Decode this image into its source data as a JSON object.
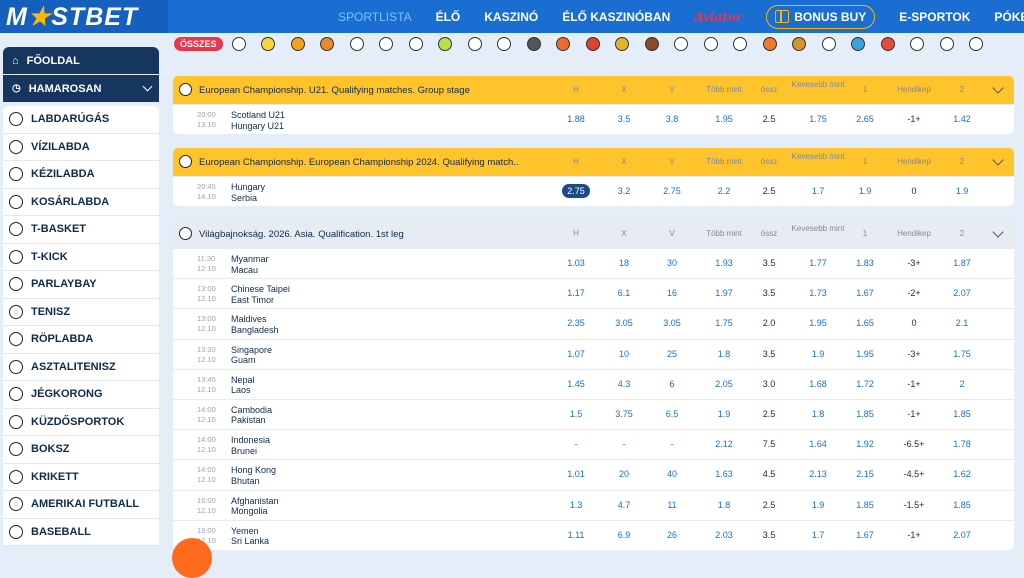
{
  "brand": {
    "logo_left": "M",
    "logo_star": "★",
    "logo_right": "STBET"
  },
  "topnav": {
    "items": [
      "SPORTLISTA",
      "ÉLŐ",
      "KASZINÓ",
      "ÉLŐ KASZINÓBAN",
      "Aviator",
      "BONUS BUY",
      "E-SPORTOK",
      "PÓKER"
    ]
  },
  "sidebar": {
    "home": "FŐOLDAL",
    "soon": "HAMAROSAN",
    "sports": [
      "LABDARÚGÁS",
      "VÍZILABDA",
      "KÉZILABDA",
      "KOSÁRLABDA",
      "T-BASKET",
      "T-KICK",
      "PARLAYBAY",
      "TENISZ",
      "RÖPLABDA",
      "ASZTALITENISZ",
      "JÉGKORONG",
      "KÜZDŐSPORTOK",
      "BOKSZ",
      "KRIKETT",
      "AMERIKAI FUTBALL",
      "BASEBALL"
    ]
  },
  "sport_filter": {
    "all_label": "ÖSSZES"
  },
  "columns": [
    "H",
    "X",
    "V",
    "Több mint",
    "össz",
    "Kevesebb mint",
    "1",
    "Hendikep",
    "2"
  ],
  "blocks": [
    {
      "title": "European Championship. U21. Qualifying matches. Group stage",
      "matches": [
        {
          "time": "20:00",
          "date": "13.10",
          "home": "Scotland U21",
          "away": "Hungary U21",
          "odds": [
            "1.88",
            "3.5",
            "3.8",
            "1.95",
            "2.5",
            "1.75",
            "2.65",
            "-1+",
            "1.42"
          ]
        }
      ]
    },
    {
      "title": "European Championship. European Championship 2024. Qualifying match...",
      "matches": [
        {
          "time": "20:45",
          "date": "14.10",
          "home": "Hungary",
          "away": "Serbia",
          "odds": [
            "2.75",
            "3.2",
            "2.75",
            "2.2",
            "2.5",
            "1.7",
            "1.9",
            "0",
            "1.9"
          ]
        }
      ]
    },
    {
      "title": "Világbajnokság. 2026. Asia. Qualification. 1st leg",
      "matches": [
        {
          "time": "11:30",
          "date": "12.10",
          "home": "Myanmar",
          "away": "Macau",
          "odds": [
            "1.03",
            "18",
            "30",
            "1.93",
            "3.5",
            "1.77",
            "1.83",
            "-3+",
            "1.87"
          ]
        },
        {
          "time": "13:00",
          "date": "12.10",
          "home": "Chinese Taipei",
          "away": "East Timor",
          "odds": [
            "1.17",
            "6.1",
            "16",
            "1.97",
            "3.5",
            "1.73",
            "1.67",
            "-2+",
            "2.07"
          ]
        },
        {
          "time": "13:00",
          "date": "12.10",
          "home": "Maldives",
          "away": "Bangladesh",
          "odds": [
            "2.35",
            "3.05",
            "3.05",
            "1.75",
            "2.0",
            "1.95",
            "1.65",
            "0",
            "2.1"
          ]
        },
        {
          "time": "13:30",
          "date": "12.10",
          "home": "Singapore",
          "away": "Guam",
          "odds": [
            "1.07",
            "10",
            "25",
            "1.8",
            "3.5",
            "1.9",
            "1.95",
            "-3+",
            "1.75"
          ]
        },
        {
          "time": "13:45",
          "date": "12.10",
          "home": "Nepal",
          "away": "Laos",
          "odds": [
            "1.45",
            "4.3",
            "6",
            "2.05",
            "3.0",
            "1.68",
            "1.72",
            "-1+",
            "2"
          ]
        },
        {
          "time": "14:00",
          "date": "12.10",
          "home": "Cambodia",
          "away": "Pakistan",
          "odds": [
            "1.5",
            "3.75",
            "6.5",
            "1.9",
            "2.5",
            "1.8",
            "1.85",
            "-1+",
            "1.85"
          ]
        },
        {
          "time": "14:00",
          "date": "12.10",
          "home": "Indonesia",
          "away": "Brunei",
          "odds": [
            "-",
            "-",
            "-",
            "2.12",
            "7.5",
            "1.64",
            "1.92",
            "-6.5+",
            "1.78"
          ]
        },
        {
          "time": "14:00",
          "date": "12.10",
          "home": "Hong Kong",
          "away": "Bhutan",
          "odds": [
            "1.01",
            "20",
            "40",
            "1.63",
            "4.5",
            "2.13",
            "2.15",
            "-4.5+",
            "1.62"
          ]
        },
        {
          "time": "16:00",
          "date": "12.10",
          "home": "Afghanistan",
          "away": "Mongolia",
          "odds": [
            "1.3",
            "4.7",
            "11",
            "1.8",
            "2.5",
            "1.9",
            "1.85",
            "-1.5+",
            "1.85"
          ]
        },
        {
          "time": "19:00",
          "date": "12.10",
          "home": "Yemen",
          "away": "Sri Lanka",
          "odds": [
            "1.11",
            "6.9",
            "26",
            "2.03",
            "3.5",
            "1.7",
            "1.67",
            "-1+",
            "2.07"
          ]
        }
      ]
    }
  ]
}
